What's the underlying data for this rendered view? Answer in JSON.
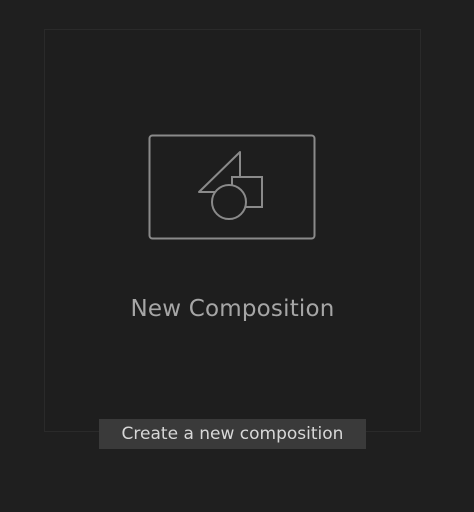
{
  "new_composition": {
    "label": "New Composition",
    "icon": "composition-shapes-icon"
  },
  "tooltip": {
    "text": "Create a new composition"
  },
  "colors": {
    "background": "#1f1f1f",
    "panel_border": "#2a2a2a",
    "icon_stroke": "#8a8a8a",
    "label": "#a6a6a6",
    "tooltip_bg": "#3a3a3a",
    "tooltip_text": "#d8d8d8"
  }
}
